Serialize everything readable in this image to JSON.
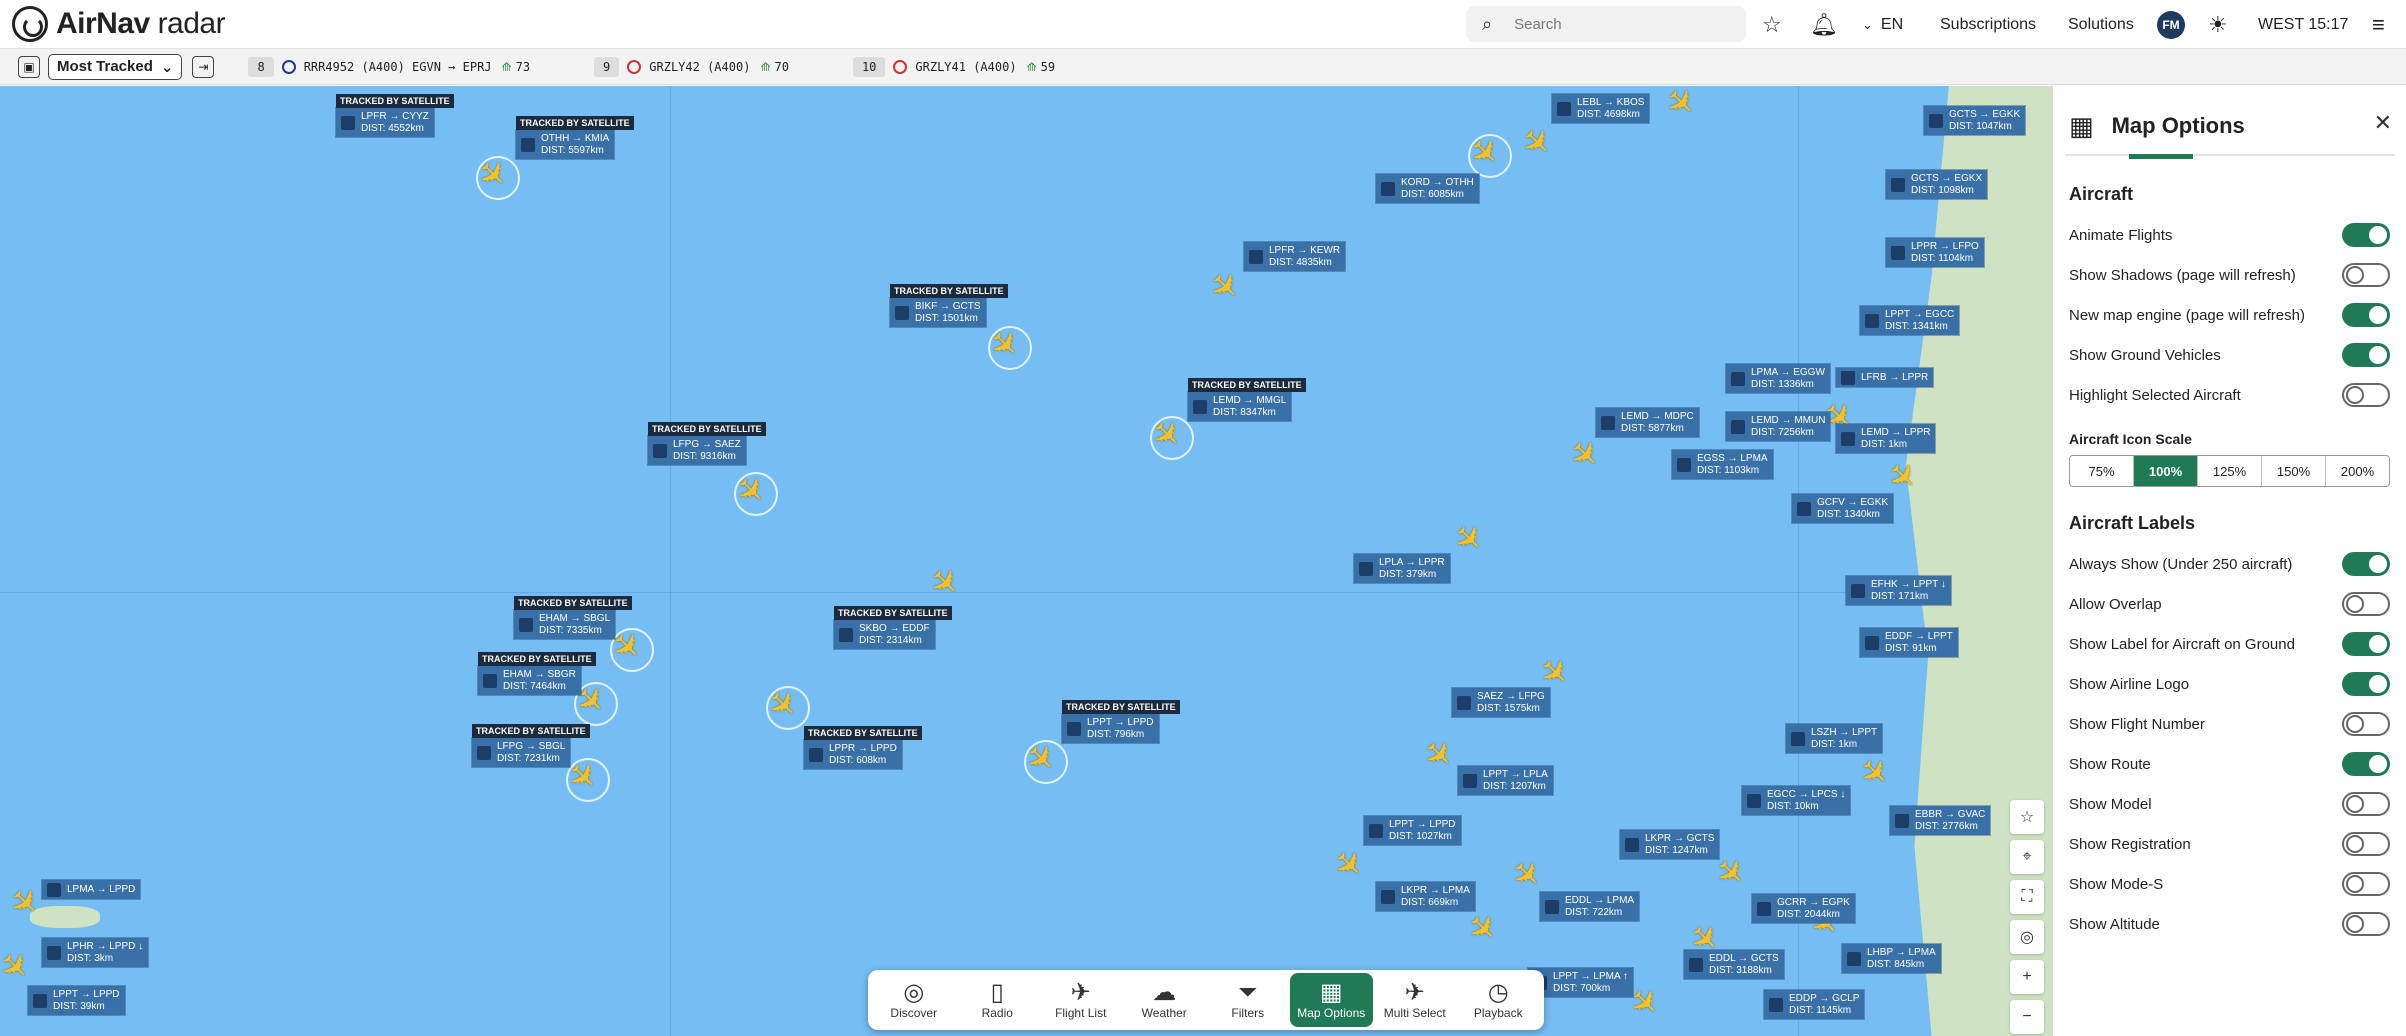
{
  "app": {
    "logo_bold": "AirNav",
    "logo_light": "radar"
  },
  "topbar": {
    "search_placeholder": "Search",
    "language": "EN",
    "subscriptions": "Subscriptions",
    "solutions": "Solutions",
    "avatar": "FM",
    "clock": "WEST 15:17"
  },
  "tracked": {
    "selector": "Most Tracked",
    "items": [
      {
        "rank": "8",
        "text": "RRR4952 (A400) EGVN → EPRJ",
        "count": "73"
      },
      {
        "rank": "9",
        "text": "GRZLY42 (A400)",
        "count": "70"
      },
      {
        "rank": "10",
        "text": "GRZLY41 (A400)",
        "count": "59"
      }
    ]
  },
  "map_labels": [
    {
      "route": "LPFR → CYYZ",
      "dist": "DIST: 4552km",
      "sat": "TRACKED BY SATELLITE"
    },
    {
      "route": "OTHH → KMIA",
      "dist": "DIST: 5597km",
      "sat": "TRACKED BY SATELLITE"
    },
    {
      "route": "LEBL → KBOS",
      "dist": "DIST: 4698km",
      "sat": ""
    },
    {
      "route": "KORD → OTHH",
      "dist": "DIST: 6085km",
      "sat": ""
    },
    {
      "route": "LPFR → KEWR",
      "dist": "DIST: 4835km",
      "sat": ""
    },
    {
      "route": "BIKF → GCTS",
      "dist": "DIST: 1501km",
      "sat": "TRACKED BY SATELLITE"
    },
    {
      "route": "LEMD → MMGL",
      "dist": "DIST: 8347km",
      "sat": "TRACKED BY SATELLITE"
    },
    {
      "route": "LFPG → SAEZ",
      "dist": "DIST: 9316km",
      "sat": "TRACKED BY SATELLITE"
    },
    {
      "route": "LEMD → MDPC",
      "dist": "DIST: 5877km",
      "sat": ""
    },
    {
      "route": "LEMD → MMUN",
      "dist": "DIST: 7256km",
      "sat": ""
    },
    {
      "route": "LPMA → EGGW",
      "dist": "DIST: 1336km",
      "sat": ""
    },
    {
      "route": "LFRB → LPPR",
      "dist": "",
      "sat": ""
    },
    {
      "route": "LEMD → LPPR",
      "dist": "DIST: 1km",
      "sat": ""
    },
    {
      "route": "EGSS → LPMA",
      "dist": "DIST: 1103km",
      "sat": ""
    },
    {
      "route": "GCFV → EGKK",
      "dist": "DIST: 1340km",
      "sat": ""
    },
    {
      "route": "LPLA → LPPR",
      "dist": "DIST: 379km",
      "sat": ""
    },
    {
      "route": "EHAM → SBGL",
      "dist": "DIST: 7335km",
      "sat": "TRACKED BY SATELLITE"
    },
    {
      "route": "EHAM → SBGR",
      "dist": "DIST: 7464km",
      "sat": "TRACKED BY SATELLITE"
    },
    {
      "route": "LFPG → SBGL",
      "dist": "DIST: 7231km",
      "sat": "TRACKED BY SATELLITE"
    },
    {
      "route": "SKBO → EDDF",
      "dist": "DIST: 2314km",
      "sat": "TRACKED BY SATELLITE"
    },
    {
      "route": "LPPR → LPPD",
      "dist": "DIST: 608km",
      "sat": "TRACKED BY SATELLITE"
    },
    {
      "route": "LPPT → LPPD",
      "dist": "DIST: 796km",
      "sat": "TRACKED BY SATELLITE"
    },
    {
      "route": "SAEZ → LFPG",
      "dist": "DIST: 1575km",
      "sat": ""
    },
    {
      "route": "EFHK → LPPT ↓",
      "dist": "DIST: 171km",
      "sat": ""
    },
    {
      "route": "EDDF → LPPT",
      "dist": "DIST: 91km",
      "sat": ""
    },
    {
      "route": "LPPT → LPLA",
      "dist": "DIST: 1207km",
      "sat": ""
    },
    {
      "route": "LSZH → LPPT",
      "dist": "DIST: 1km",
      "sat": ""
    },
    {
      "route": "EGCC → LPCS ↓",
      "dist": "DIST: 10km",
      "sat": ""
    },
    {
      "route": "LPPT → LPPD",
      "dist": "DIST: 1027km",
      "sat": ""
    },
    {
      "route": "LKPR → GCTS",
      "dist": "DIST: 1247km",
      "sat": ""
    },
    {
      "route": "LKPR → LPMA",
      "dist": "DIST: 669km",
      "sat": ""
    },
    {
      "route": "EDDL → LPMA",
      "dist": "DIST: 722km",
      "sat": ""
    },
    {
      "route": "GCRR → EGPK",
      "dist": "DIST: 2044km",
      "sat": ""
    },
    {
      "route": "LHBP → LPMA",
      "dist": "DIST: 845km",
      "sat": ""
    },
    {
      "route": "EDDL → GCTS",
      "dist": "DIST: 3188km",
      "sat": ""
    },
    {
      "route": "LPPT → LPMA ↑",
      "dist": "DIST: 700km",
      "sat": ""
    },
    {
      "route": "EDDP → GCLP",
      "dist": "DIST: 1145km",
      "sat": ""
    },
    {
      "route": "LPMA → LPPD",
      "dist": "",
      "sat": ""
    },
    {
      "route": "LPHR → LPPD ↓",
      "dist": "DIST: 3km",
      "sat": ""
    },
    {
      "route": "LPPT → LPPD",
      "dist": "DIST: 39km",
      "sat": ""
    },
    {
      "route": "GCTS → EGKK",
      "dist": "DIST: 1047km",
      "sat": ""
    },
    {
      "route": "GCTS → EGKX",
      "dist": "DIST: 1098km",
      "sat": ""
    },
    {
      "route": "LPPR → LFPO",
      "dist": "DIST: 1104km",
      "sat": ""
    },
    {
      "route": "LPPT → EGCC",
      "dist": "DIST: 1341km",
      "sat": ""
    },
    {
      "route": "EBBR → GVAC",
      "dist": "DIST: 2776km",
      "sat": ""
    }
  ],
  "dock": [
    {
      "label": "Discover",
      "icon": "◎"
    },
    {
      "label": "Radio",
      "icon": "▯"
    },
    {
      "label": "Flight List",
      "icon": "✈"
    },
    {
      "label": "Weather",
      "icon": "☁"
    },
    {
      "label": "Filters",
      "icon": "⏷"
    },
    {
      "label": "Map Options",
      "icon": "▦"
    },
    {
      "label": "Multi Select",
      "icon": "✈"
    },
    {
      "label": "Playback",
      "icon": "◷"
    }
  ],
  "panel": {
    "title": "Map Options",
    "aircraft_section": "Aircraft",
    "aircraft_toggles": [
      {
        "label": "Animate Flights",
        "on": true
      },
      {
        "label": "Show Shadows (page will refresh)",
        "on": false
      },
      {
        "label": "New map engine (page will refresh)",
        "on": true
      },
      {
        "label": "Show Ground Vehicles",
        "on": true
      },
      {
        "label": "Highlight Selected Aircraft",
        "on": false
      }
    ],
    "scale_title": "Aircraft Icon Scale",
    "scale_options": [
      "75%",
      "100%",
      "125%",
      "150%",
      "200%"
    ],
    "scale_selected": "100%",
    "labels_section": "Aircraft Labels",
    "label_toggles": [
      {
        "label": "Always Show (Under 250 aircraft)",
        "on": true
      },
      {
        "label": "Allow Overlap",
        "on": false
      },
      {
        "label": "Show Label for Aircraft on Ground",
        "on": true
      },
      {
        "label": "Show Airline Logo",
        "on": true
      },
      {
        "label": "Show Flight Number",
        "on": false
      },
      {
        "label": "Show Route",
        "on": true
      },
      {
        "label": "Show Model",
        "on": false
      },
      {
        "label": "Show Registration",
        "on": false
      },
      {
        "label": "Show Mode-S",
        "on": false
      },
      {
        "label": "Show Altitude",
        "on": false
      }
    ]
  },
  "colors": {
    "ocean": "#75bdf3",
    "label": "#3a70a8",
    "accent": "#1f7a55",
    "plane": "#f2c12e"
  }
}
